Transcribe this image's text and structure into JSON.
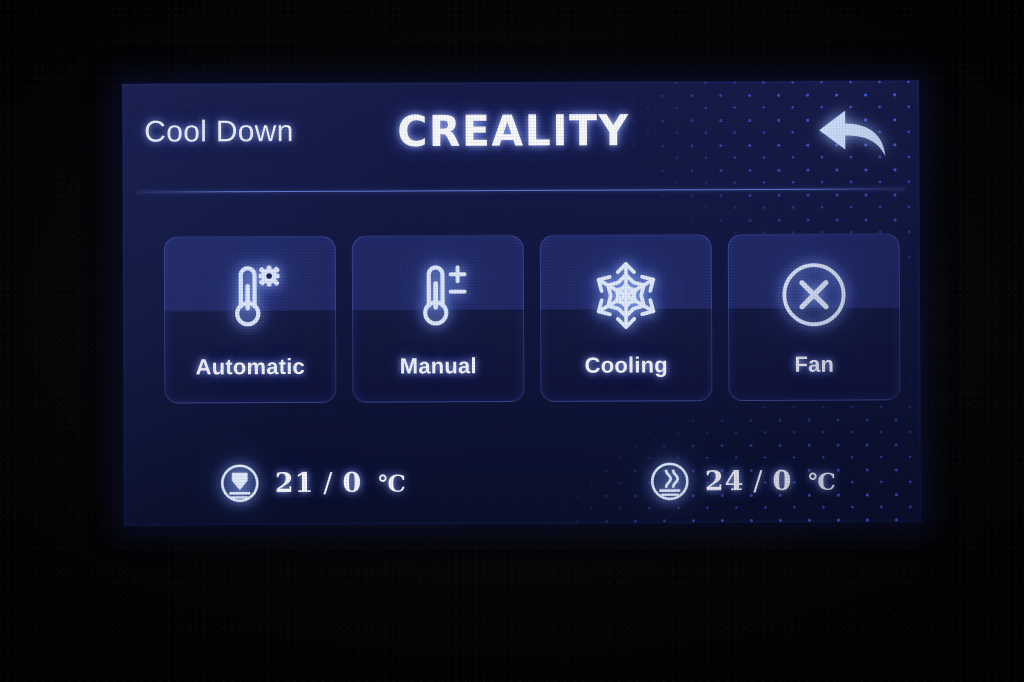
{
  "device": {
    "brand": "CREALITY",
    "screen_title": "Cool Down"
  },
  "header": {
    "title": "Cool Down",
    "brand": "CREALITY",
    "back_icon": "back-arrow-icon"
  },
  "tiles": [
    {
      "label": "Automatic",
      "icon": "thermometer-gear-icon"
    },
    {
      "label": "Manual",
      "icon": "thermometer-plus-minus-icon"
    },
    {
      "label": "Cooling",
      "icon": "snowflake-icon"
    },
    {
      "label": "Fan",
      "icon": "circle-x-icon"
    }
  ],
  "readouts": [
    {
      "name": "nozzle",
      "icon": "nozzle-icon",
      "current": "21",
      "separator": "/",
      "target": "0",
      "unit": "℃"
    },
    {
      "name": "bed",
      "icon": "heated-bed-icon",
      "current": "24",
      "separator": "/",
      "target": "0",
      "unit": "℃"
    }
  ],
  "colors": {
    "screen_bg_top": "#171c4a",
    "screen_bg_bottom": "#0a0f2b",
    "tile_top": "#222a66",
    "tile_bottom": "#10143a",
    "glow": "#96aaff",
    "text": "#f4f5ff",
    "star_dot": "#4a64e8",
    "divider": "#7896ff"
  }
}
